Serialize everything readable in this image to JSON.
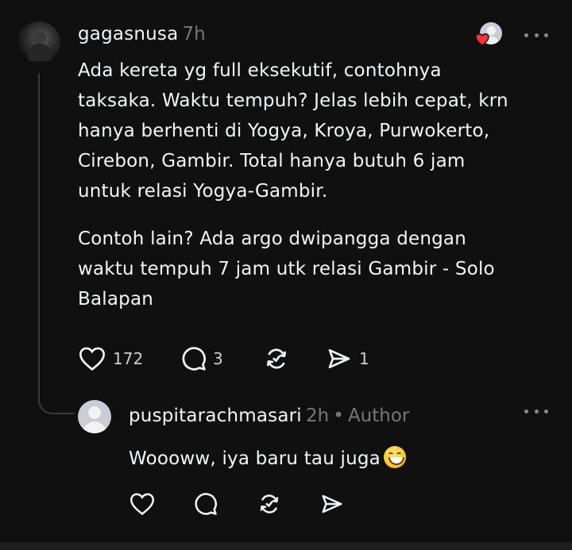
{
  "post": {
    "username": "gagasnusa",
    "time": "7h",
    "paragraph1": [
      "Ada kereta yg full eksekutif, contohnya",
      "taksaka. Waktu tempuh? Jelas lebih cepat, krn",
      "hanya berhenti di Yogya, Kroya, Purwokerto,",
      "Cirebon, Gambir. Total hanya butuh 6 jam",
      "untuk relasi Yogya-Gambir."
    ],
    "paragraph2": [
      "Contoh lain? Ada argo dwipangga dengan",
      "waktu tempuh 7 jam utk relasi Gambir - Solo",
      "Balapan"
    ],
    "likes": "172",
    "replies": "3",
    "shares": "1"
  },
  "reply": {
    "username": "puspitarachmasari",
    "time": "2h",
    "separator": "•",
    "badge": "Author",
    "text": "Woooww, iya baru tau juga"
  },
  "icons": {
    "like": "heart-icon",
    "comment": "comment-icon",
    "repost": "repost-icon",
    "share": "send-icon",
    "more": "more-dots-icon",
    "liked_by": "liked-by-author-avatar-icon",
    "emoji": "grinning-face-emoji"
  },
  "colors": {
    "background": "#101010",
    "text": "#f3f5f7",
    "muted": "#777777",
    "heart": "#ff3040"
  }
}
